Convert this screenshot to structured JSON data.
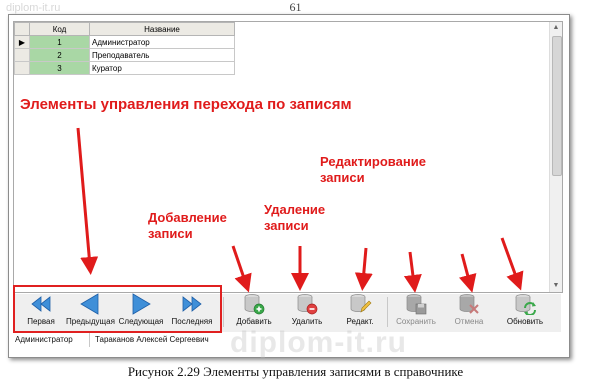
{
  "page_number": "61",
  "watermark": "diplom-it.ru",
  "watermark_large": "diplom-it.ru",
  "grid": {
    "columns": [
      "Код",
      "Название"
    ],
    "rows": [
      {
        "code": "1",
        "name": "Администратор"
      },
      {
        "code": "2",
        "name": "Преподаватель"
      },
      {
        "code": "3",
        "name": "Куратор"
      }
    ],
    "row_selector": "▶"
  },
  "toolbar": {
    "nav": {
      "first_label": "Первая",
      "prev_label": "Предыдущая",
      "next_label": "Следующая",
      "last_label": "Последняя"
    },
    "add_label": "Добавить",
    "delete_label": "Удалить",
    "edit_label": "Редакт.",
    "save_label": "Сохранить",
    "cancel_label": "Отмена",
    "refresh_label": "Обновить"
  },
  "status_bar": {
    "role": "Администратор",
    "user": "Тараканов Алексей Сергеевич"
  },
  "annotations": {
    "nav": "Элементы управления перехода по записям",
    "add": "Добавление\nзаписи",
    "delete": "Удаление\nзаписи",
    "edit": "Редактирование\nзаписи"
  },
  "caption": "Рисунок 2.29 Элементы управления записями в справочнике",
  "colors": {
    "annotation": "#e01b1b",
    "code_cell": "#a9d7a5",
    "nav_blue": "#3f8fd8"
  }
}
